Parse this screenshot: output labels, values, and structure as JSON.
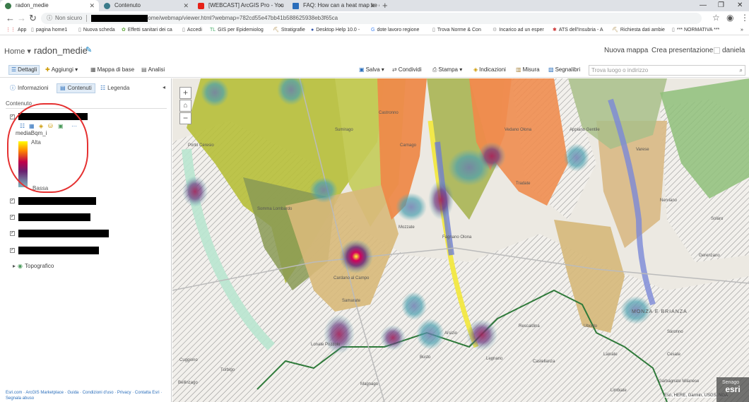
{
  "browser": {
    "tabs": [
      {
        "label": "radon_medie",
        "active": true
      },
      {
        "label": "Contenuto"
      },
      {
        "label": "[WEBCAST] ArcGIS Pro - You"
      },
      {
        "label": "FAQ: How can a heat map be cr"
      }
    ],
    "address": {
      "security": "Non sicuro",
      "url_visible": "ome/webmap/viewer.html?webmap=782cd55e47bb41b588625938eb3f65ca"
    },
    "bookmarks": [
      "App",
      "pagina home1",
      "Nuova scheda",
      "Effetti sanitari dei ca",
      "Accedi",
      "GIS per Epidemiolog",
      "Stratigrafie",
      "Desktop Help 10.0 -",
      "dote lavoro regione",
      "Trova Norme & Con",
      "Incarico ad un esper",
      "ATS dell'Insubria - A",
      "Richiesta dati ambie",
      "*** NORMATIVA ***"
    ]
  },
  "header": {
    "home": "Home",
    "map_title": "radon_medie",
    "new_map": "Nuova mappa",
    "create_presentation": "Crea presentazione",
    "user": "daniela"
  },
  "toolbar": {
    "details": "Dettagli",
    "add": "Aggiungi",
    "basemap": "Mappa di base",
    "analysis": "Analisi",
    "save": "Salva",
    "share": "Condividi",
    "print": "Stampa",
    "directions": "Indicazioni",
    "measure": "Misura",
    "bookmarks": "Segnalibri",
    "search_placeholder": "Trova luogo o indirizzo"
  },
  "panel": {
    "tabs": {
      "info": "Informazioni",
      "contents": "Contenuti",
      "legend": "Legenda"
    },
    "contents_heading": "Contenuto",
    "layer": {
      "field": "mediaBqm_i",
      "ramp_high": "Alta",
      "ramp_low": "Bassa"
    },
    "basemap_layer": "Topografico",
    "footer": "Esri.com · ArcGIS Marketplace · Guida · Condizioni d'uso · Privacy · Contatta Esri · Segnala abuso"
  },
  "map": {
    "attribution": "Esri, HERE, Garmin, USGS, NGA",
    "esri_logo": "esri",
    "esri_label": "Senago",
    "places": [
      "Porto Ceresio",
      "Sumirago",
      "Castronno",
      "Carnago",
      "Appiano Gentile",
      "Vedano Olona",
      "Mozzate",
      "Fagnano Olona",
      "Somma Lombardo",
      "Cardano al Campo",
      "Samarate",
      "Arsizio",
      "Legnano",
      "Rescaldina",
      "Uboldo",
      "Cesate",
      "Garbagnate Milanese",
      "Limbiate",
      "Varese",
      "Lonate Pozzolo",
      "Magnago",
      "Turbigo",
      "Cuggiono",
      "Castellanza",
      "Lainate",
      "Saronno",
      "Solaro",
      "Tradate",
      "Gerenzano",
      "Bellinzago",
      "Nerviano",
      "Busto"
    ],
    "region_label": "MONZA E BRIANZA"
  }
}
